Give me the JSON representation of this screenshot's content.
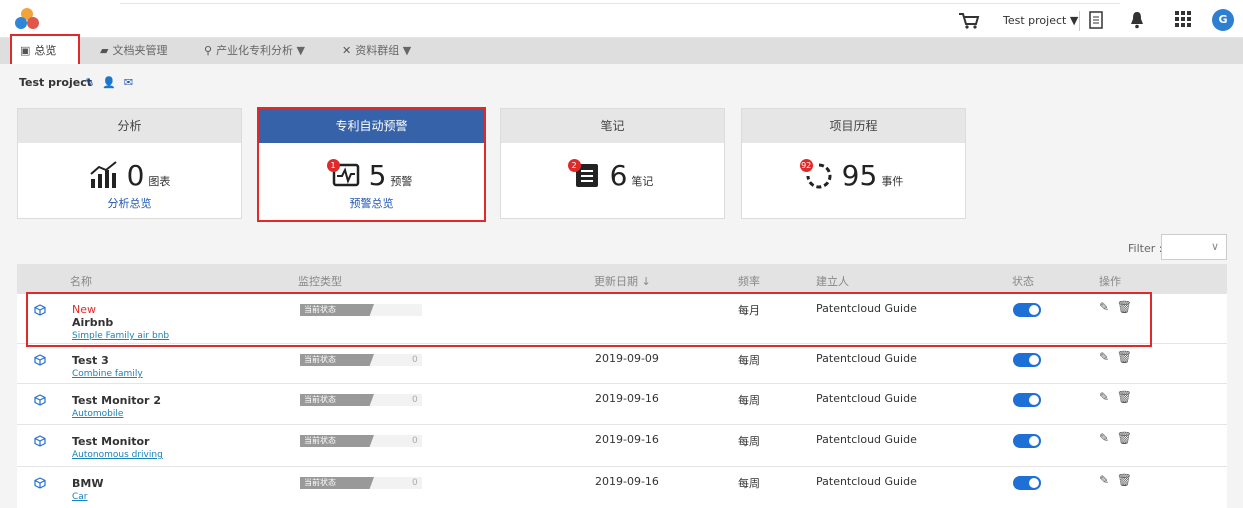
{
  "topbar": {
    "project_select": "Test project ▼",
    "avatar_initial": "G"
  },
  "nav": {
    "items": [
      {
        "label": "总览",
        "icon": "briefcase-icon"
      },
      {
        "label": "文档夹管理",
        "icon": "folder-icon"
      },
      {
        "label": "产业化专利分析 ▼",
        "icon": "analytics-icon"
      },
      {
        "label": "资料群组 ▼",
        "icon": "cluster-icon"
      }
    ],
    "active_index": 0
  },
  "breadcrumb": {
    "title": "Test project",
    "icons": [
      "edit-icon",
      "add-user-icon",
      "mail-icon"
    ]
  },
  "cards": [
    {
      "header": "分析",
      "value": "0",
      "unit": "图表",
      "link": "分析总览",
      "icon": "chart-icon",
      "badge": ""
    },
    {
      "header": "专利自动预警",
      "value": "5",
      "unit": "预警",
      "link": "预警总览",
      "icon": "monitor-icon",
      "badge": "1"
    },
    {
      "header": "笔记",
      "value": "6",
      "unit": "笔记",
      "link": "",
      "icon": "notes-icon",
      "badge": "2"
    },
    {
      "header": "项目历程",
      "value": "95",
      "unit": "事件",
      "link": "",
      "icon": "history-icon",
      "badge": "92"
    }
  ],
  "filter": {
    "label": "Filter :",
    "value": ""
  },
  "table": {
    "columns": [
      "名称",
      "监控类型",
      "更新日期 ↓",
      "频率",
      "建立人",
      "状态",
      "操作"
    ],
    "rows": [
      {
        "new_tag": "New",
        "name": "Airbnb",
        "family": "Simple Family air bnb",
        "monitor_type": "当前状态",
        "count": "",
        "date": "",
        "frequency": "每月",
        "creator": "Patentcloud Guide",
        "enabled": true
      },
      {
        "new_tag": "",
        "name": "Test 3",
        "family": "Combine family",
        "monitor_type": "当前状态",
        "count": "0",
        "date": "2019-09-09",
        "frequency": "每周",
        "creator": "Patentcloud Guide",
        "enabled": true
      },
      {
        "new_tag": "",
        "name": "Test Monitor 2",
        "family": "Automobile",
        "monitor_type": "当前状态",
        "count": "0",
        "date": "2019-09-16",
        "frequency": "每周",
        "creator": "Patentcloud Guide",
        "enabled": true
      },
      {
        "new_tag": "",
        "name": "Test Monitor",
        "family": "Autonomous driving",
        "monitor_type": "当前状态",
        "count": "0",
        "date": "2019-09-16",
        "frequency": "每周",
        "creator": "Patentcloud Guide",
        "enabled": true
      },
      {
        "new_tag": "",
        "name": "BMW",
        "family": "Car",
        "monitor_type": "当前状态",
        "count": "0",
        "date": "2019-09-16",
        "frequency": "每周",
        "creator": "Patentcloud Guide",
        "enabled": true
      }
    ]
  },
  "colors": {
    "accent": "#3562a8",
    "highlight": "#e02a2a",
    "toggle": "#1e70d6",
    "link": "#1a82b8"
  }
}
